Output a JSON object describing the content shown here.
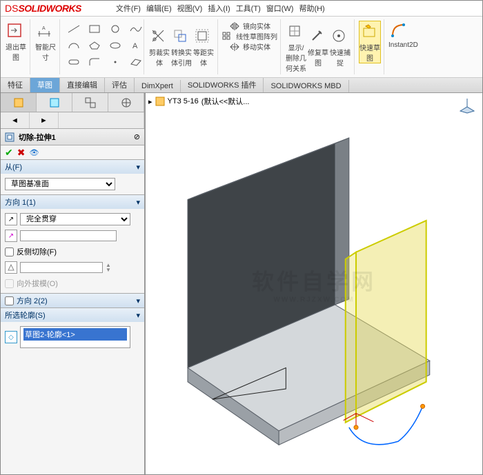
{
  "app": {
    "logo_prefix": "DS",
    "logo_text": "SOLIDWORKS"
  },
  "menus": [
    "文件(F)",
    "编辑(E)",
    "视图(V)",
    "插入(I)",
    "工具(T)",
    "窗口(W)",
    "帮助(H)"
  ],
  "ribbon": {
    "g1a": "退出草图",
    "g1b": "智能尺寸",
    "g2a": "剪裁实体",
    "g2b": "转换实体引用",
    "g2c": "等距实体",
    "g3a": "镜向实体",
    "g3b": "线性草图阵列",
    "g3c": "移动实体",
    "g4a": "显示/删除几何关系",
    "g4b": "修复草图",
    "g4c": "快速捕捉",
    "g5": "快速草图",
    "g6": "Instant2D"
  },
  "tabs": [
    "特征",
    "草图",
    "直接编辑",
    "评估",
    "DimXpert",
    "SOLIDWORKS 插件",
    "SOLIDWORKS MBD"
  ],
  "active_tab_index": 1,
  "breadcrumb": {
    "part": "YT3 5-16",
    "suffix": "(默认<<默认..."
  },
  "feature": {
    "title": "切除-拉伸1",
    "from": {
      "label": "从(F)",
      "plane": "草图基准面"
    },
    "dir1": {
      "label": "方向 1(1)",
      "end": "完全贯穿",
      "value": "",
      "reverse_label": "反侧切除(F)",
      "draft_label": "向外拔模(O)"
    },
    "dir2": {
      "label": "方向 2(2)"
    },
    "contours": {
      "label": "所选轮廓(S)",
      "item": "草图2-轮廓<1>"
    }
  },
  "watermark": {
    "main": "软件自学网",
    "sub": "WWW.RJZXW.COM"
  }
}
